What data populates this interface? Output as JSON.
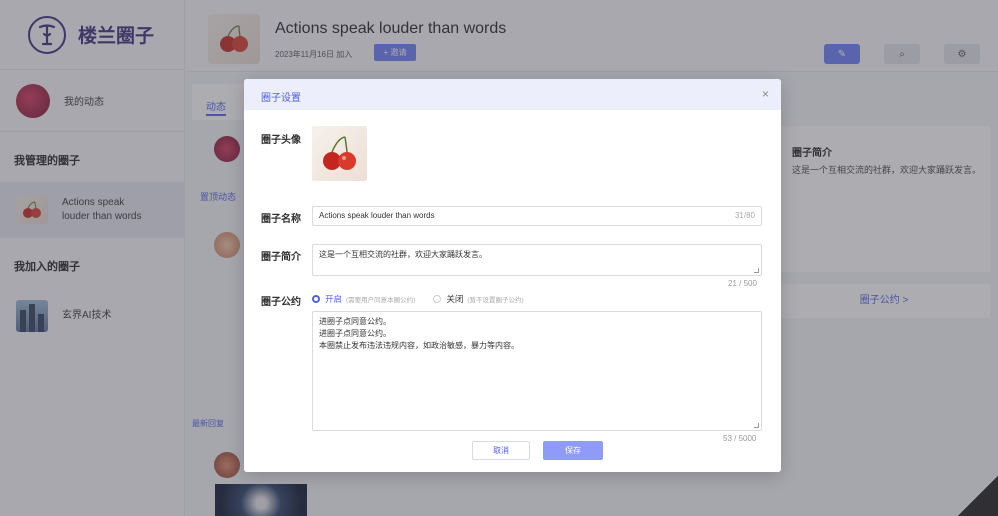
{
  "app": {
    "name": "楼兰圈子",
    "logo_glyph": "𝕿"
  },
  "sidebar": {
    "my_feed": "我的动态",
    "managed_title": "我管理的圈子",
    "managed_items": [
      {
        "name": "Actions speak louder than words"
      }
    ],
    "joined_title": "我加入的圈子",
    "joined_items": [
      {
        "name": "玄界AI技术"
      }
    ]
  },
  "header": {
    "circle_title": "Actions speak louder than words",
    "joined_date": "2023年11月16日 加入",
    "invite_label": "+ 邀请",
    "icons": [
      "post-icon",
      "search-icon",
      "settings-icon"
    ]
  },
  "feed": {
    "tab_label": "动态",
    "pinned_label": "置顶动态",
    "latest_label": "最新回复"
  },
  "right_panel": {
    "intro_title": "圈子简介",
    "intro_text": "这是一个互相交流的社群，欢迎大家踊跃发言。",
    "rules_link": "圈子公约 >"
  },
  "modal": {
    "title": "圈子设置",
    "close_glyph": "×",
    "avatar_label": "圈子头像",
    "name_label": "圈子名称",
    "name_value": "Actions speak louder than words",
    "name_count": "31/80",
    "intro_label": "圈子简介",
    "intro_value": "这是一个互相交流的社群，欢迎大家踊跃发言。",
    "intro_count": "21 / 500",
    "rules_label": "圈子公约",
    "rules_on_label": "开启",
    "rules_on_hint": "(需要用户同意本圈公约)",
    "rules_off_label": "关闭",
    "rules_off_hint": "(暂不设置圈子公约)",
    "rules_lines": [
      "进圈子点同意公约。",
      "进圈子点同意公约。",
      "本圈禁止发布违法违规内容，如政治敏感，暴力等内容。"
    ],
    "rules_count": "53 / 5000",
    "cancel_label": "取消",
    "save_label": "保存"
  },
  "colors": {
    "accent": "#4e61e6",
    "brand": "#3b2a7a",
    "save_button": "#8e9bf7"
  }
}
